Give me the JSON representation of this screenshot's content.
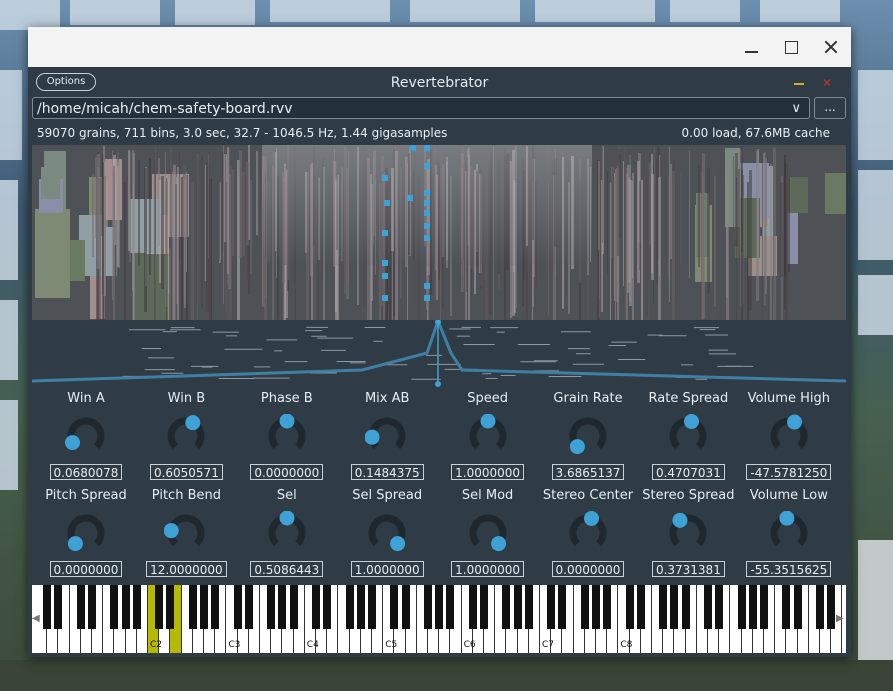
{
  "colors": {
    "accent": "#3ea2d6",
    "panel": "#2f3b45",
    "knob_track": "#1f282f",
    "key_highlight": "#b7b800"
  },
  "window": {
    "controls": [
      "minimize-icon",
      "maximize-icon",
      "close-icon"
    ]
  },
  "app": {
    "options_label": "Options",
    "title": "Revertebrator",
    "file_path": "/home/micah/chem-safety-board.rvv",
    "browse_label": "...",
    "info_left": "59070 grains, 711 bins, 3.0 sec, 32.7 - 1046.5 Hz, 1.44 gigasamples",
    "info_right": "0.00 load, 67.6MB cache"
  },
  "knobs_row1": [
    {
      "label": "Win A",
      "value": "0.0680078",
      "level": 0.07
    },
    {
      "label": "Win B",
      "value": "0.6050571",
      "level": 0.6
    },
    {
      "label": "Phase B",
      "value": "0.0000000",
      "level": 0.5
    },
    {
      "label": "Mix AB",
      "value": "0.1484375",
      "level": 0.15
    },
    {
      "label": "Speed",
      "value": "1.0000000",
      "level": 0.5
    },
    {
      "label": "Grain Rate",
      "value": "3.6865137",
      "level": 0.0
    },
    {
      "label": "Rate Spread",
      "value": "0.4707031",
      "level": 0.55
    },
    {
      "label": "Volume High",
      "value": "-47.5781250",
      "level": 0.58
    }
  ],
  "knobs_row2": [
    {
      "label": "Pitch Spread",
      "value": "0.0000000",
      "level": 0.0
    },
    {
      "label": "Pitch Bend",
      "value": "12.0000000",
      "level": 0.2
    },
    {
      "label": "Sel",
      "value": "0.5086443",
      "level": 0.5
    },
    {
      "label": "Sel Spread",
      "value": "1.0000000",
      "level": 1.0
    },
    {
      "label": "Sel Mod",
      "value": "1.0000000",
      "level": 1.0
    },
    {
      "label": "Stereo Center",
      "value": "0.0000000",
      "level": 0.55
    },
    {
      "label": "Stereo Spread",
      "value": "0.3731381",
      "level": 0.38
    },
    {
      "label": "Volume Low",
      "value": "-55.3515625",
      "level": 0.47
    }
  ],
  "piano": {
    "octave_labels": [
      "C2",
      "C3",
      "C4",
      "C5",
      "C6",
      "C7",
      "C8"
    ],
    "highlighted_keys": [
      "C2",
      "E2"
    ]
  }
}
